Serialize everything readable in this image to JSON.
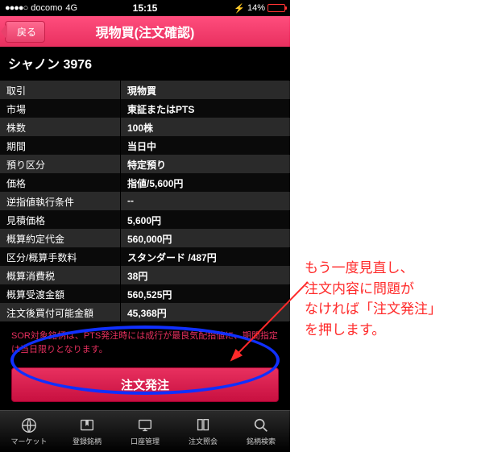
{
  "status": {
    "signal_dots": "●●●●○",
    "carrier": "docomo",
    "network": "4G",
    "time": "15:15",
    "charging_icon": "⚡",
    "battery_pct": "14%"
  },
  "header": {
    "back_label": "戻る",
    "title": "現物買(注文確認)"
  },
  "stock_name": "シャノン 3976",
  "rows": [
    {
      "label": "取引",
      "value": "現物買"
    },
    {
      "label": "市場",
      "value": "東証またはPTS"
    },
    {
      "label": "株数",
      "value": "100株"
    },
    {
      "label": "期間",
      "value": "当日中"
    },
    {
      "label": "預り区分",
      "value": "特定預り"
    },
    {
      "label": "価格",
      "value": "指値/5,600円"
    },
    {
      "label": "逆指値執行条件",
      "value": "--"
    },
    {
      "label": "見積価格",
      "value": "5,600円"
    },
    {
      "label": "概算約定代金",
      "value": "560,000円"
    },
    {
      "label": "区分/概算手数料",
      "value": "スタンダード /487円"
    },
    {
      "label": "概算消費税",
      "value": "38円"
    },
    {
      "label": "概算受渡金額",
      "value": "560,525円"
    },
    {
      "label": "注文後買付可能金額",
      "value": "45,368円"
    }
  ],
  "note_text": "SOR対象銘柄は、PTS発注時には成行が最良気配指値に、期間指定は当日限りとなります。",
  "order_button": "注文発注",
  "tabs": [
    {
      "label": "マーケット"
    },
    {
      "label": "登録銘柄"
    },
    {
      "label": "口座管理"
    },
    {
      "label": "注文照会"
    },
    {
      "label": "銘柄検索"
    }
  ],
  "annotation_lines": [
    "もう一度見直し、",
    "注文内容に問題が",
    "なければ「注文発注」",
    "を押します。"
  ]
}
